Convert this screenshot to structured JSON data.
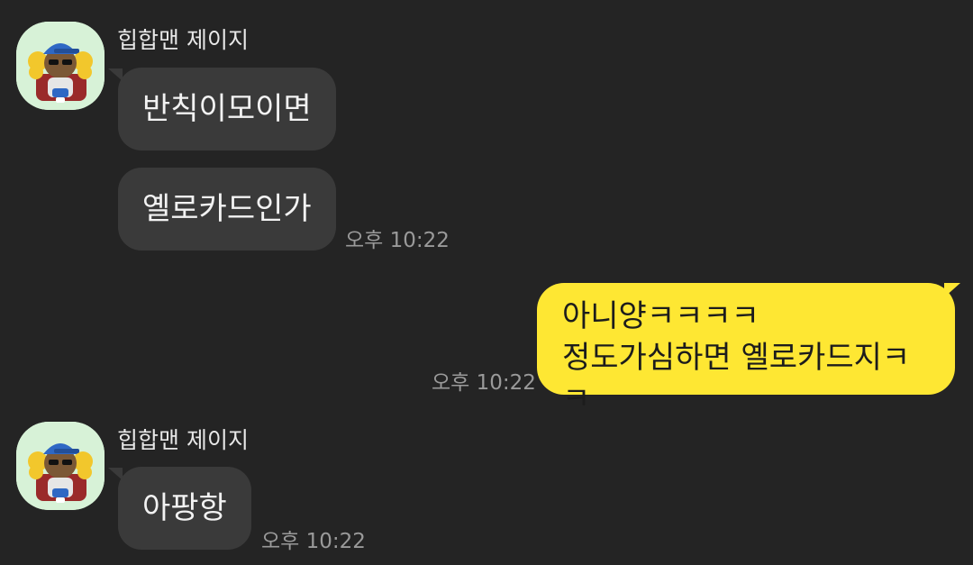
{
  "colors": {
    "background": "#242424",
    "incoming_bubble": "#3a3a3a",
    "outgoing_bubble": "#fee733",
    "avatar_bg": "#d7f2d7"
  },
  "messages": {
    "group1": {
      "sender": "힙합맨 제이지",
      "avatar_icon": "hiphop-character-avatar-icon",
      "bubble1": "반칙이모이면",
      "bubble2": "옐로카드인가",
      "time": "오후 10:22"
    },
    "outgoing": {
      "text": "아니양ㅋㅋㅋㅋ\n정도가심하면 옐로카드지ㅋㅋ",
      "time": "오후 10:22"
    },
    "group2": {
      "sender": "힙합맨 제이지",
      "avatar_icon": "hiphop-character-avatar-icon",
      "bubble1": "아팡항",
      "time": "오후 10:22"
    }
  }
}
